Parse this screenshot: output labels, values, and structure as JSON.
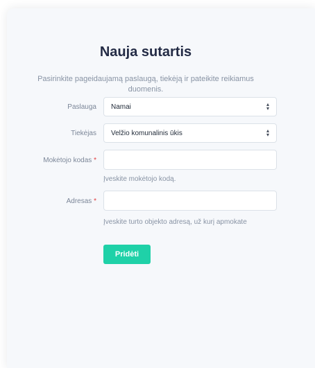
{
  "form": {
    "title": "Nauja sutartis",
    "subtitle": "Pasirinkite pageidaujamą paslaugą, tiekėją ir pateikite reikiamus duomenis.",
    "service": {
      "label": "Paslauga",
      "value": "Namai"
    },
    "supplier": {
      "label": "Tiekėjas",
      "value": "Velžio komunalinis ūkis"
    },
    "payment_code": {
      "label": "Mokėtojo kodas",
      "required_mark": "*",
      "value": "",
      "help": "Įveskite mokėtojo kodą."
    },
    "address": {
      "label": "Adresas",
      "required_mark": "*",
      "value": "",
      "help": "Įveskite turto objekto adresą, už kurį apmokate"
    },
    "submit_label": "Pridėti"
  },
  "icons": {
    "select_arrows": "sort-up-down-icon"
  },
  "colors": {
    "accent": "#1fd1a8",
    "required": "#e23c3c",
    "title": "#232b45",
    "card_background": "#f6f8fb"
  }
}
